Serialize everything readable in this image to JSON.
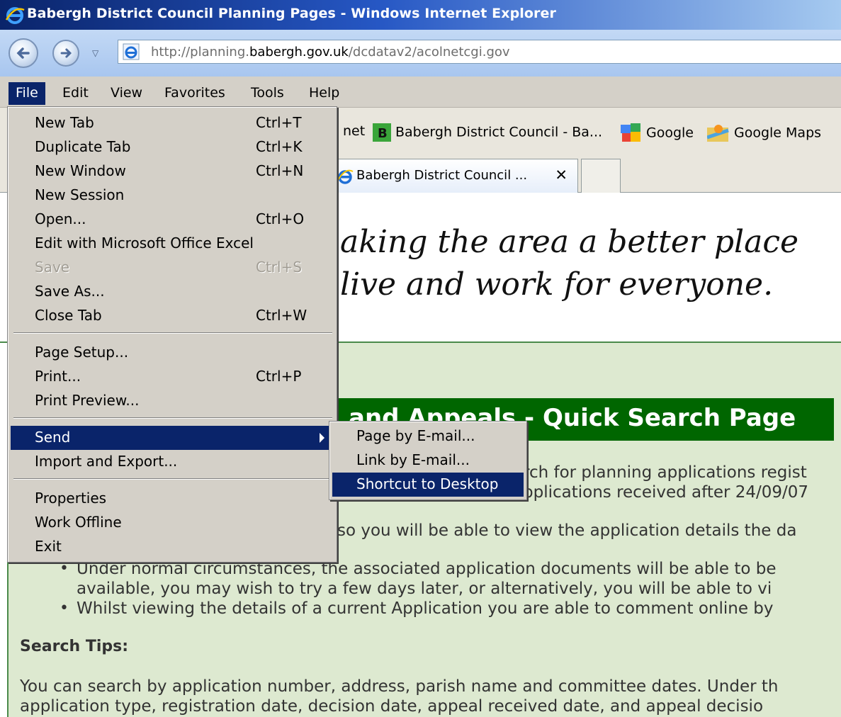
{
  "window": {
    "title": "Babergh District Council Planning Pages - Windows Internet Explorer"
  },
  "address": {
    "url_prefix": "http://planning.",
    "url_domain": "babergh.gov.uk",
    "url_path": "/dcdatav2/acolnetcgi.gov"
  },
  "menubar": {
    "items": [
      "File",
      "Edit",
      "View",
      "Favorites",
      "Tools",
      "Help"
    ]
  },
  "favorites": {
    "partial": "net",
    "items": [
      "Babergh District Council - Ba...",
      "Google",
      "Google Maps"
    ]
  },
  "tabs": {
    "active_label": "Babergh District Council ...",
    "close": "✕"
  },
  "page": {
    "slogan_line1": "aking the area a better place",
    "slogan_line2": "live and work for everyone.",
    "banner": "and Appeals - Quick Search Page",
    "line1": "rch for planning applications regist",
    "line2": "pplications received after 24/09/07",
    "line3": "so you will be able to view the application details the da",
    "bullet1a": "Under normal circumstances, the associated application documents will be able to be",
    "bullet1b": "available, you may wish to try a few days later, or alternatively, you will be able to vi",
    "bullet2": "Whilst viewing the details of a current Application you are able to comment online by",
    "search_tips": "Search Tips:",
    "tips1": "You can search by application number, address, parish name and committee dates. Under th",
    "tips2": "application type, registration date, decision date, appeal received date, and appeal decisio"
  },
  "file_menu": {
    "items": [
      {
        "label": "New Tab",
        "shortcut": "Ctrl+T"
      },
      {
        "label": "Duplicate Tab",
        "shortcut": "Ctrl+K"
      },
      {
        "label": "New Window",
        "shortcut": "Ctrl+N"
      },
      {
        "label": "New Session",
        "shortcut": ""
      },
      {
        "label": "Open...",
        "shortcut": "Ctrl+O"
      },
      {
        "label": "Edit with Microsoft Office Excel",
        "shortcut": ""
      },
      {
        "label": "Save",
        "shortcut": "Ctrl+S"
      },
      {
        "label": "Save As...",
        "shortcut": ""
      },
      {
        "label": "Close Tab",
        "shortcut": "Ctrl+W"
      },
      {
        "label": "Page Setup...",
        "shortcut": ""
      },
      {
        "label": "Print...",
        "shortcut": "Ctrl+P"
      },
      {
        "label": "Print Preview...",
        "shortcut": ""
      },
      {
        "label": "Send",
        "shortcut": ""
      },
      {
        "label": "Import and Export...",
        "shortcut": ""
      },
      {
        "label": "Properties",
        "shortcut": ""
      },
      {
        "label": "Work Offline",
        "shortcut": ""
      },
      {
        "label": "Exit",
        "shortcut": ""
      }
    ]
  },
  "send_submenu": {
    "items": [
      "Page by E-mail...",
      "Link by E-mail...",
      "Shortcut to Desktop"
    ]
  },
  "colors": {
    "highlight": "#0a246a",
    "menu_bg": "#d4d0c8",
    "banner_green": "#006600",
    "page_green": "#dde9d0"
  }
}
